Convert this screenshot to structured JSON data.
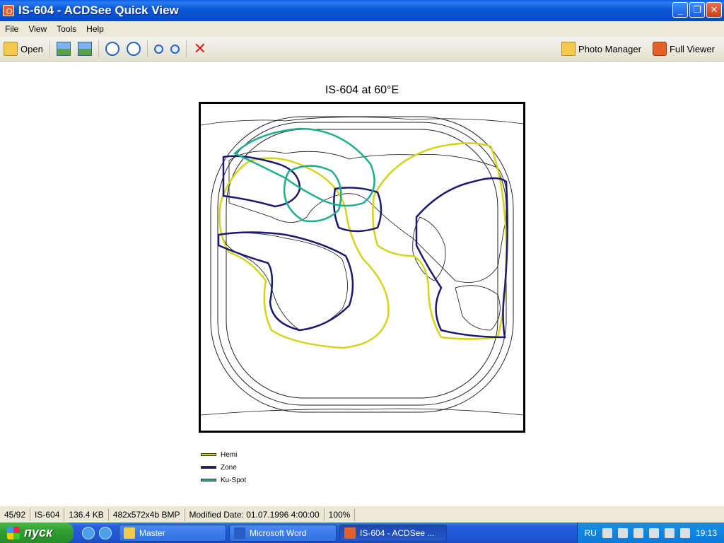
{
  "window": {
    "title": "IS-604 - ACDSee Quick View",
    "controls": [
      "minimize",
      "restore",
      "close"
    ]
  },
  "menu": [
    "File",
    "View",
    "Tools",
    "Help"
  ],
  "toolbar": {
    "open_label": "Open",
    "photo_manager_label": "Photo Manager",
    "full_viewer_label": "Full Viewer",
    "icons": [
      "open-icon",
      "previous-image-icon",
      "next-image-icon",
      "rotate-left-icon",
      "rotate-right-icon",
      "zoom-in-icon",
      "zoom-out-icon",
      "delete-icon",
      "photo-manager-icon",
      "full-viewer-icon"
    ]
  },
  "image": {
    "title": "IS-604 at 60°E",
    "legend": [
      {
        "label": "Hemi",
        "color": "#d4d41a"
      },
      {
        "label": "Zone",
        "color": "#1a1a6e"
      },
      {
        "label": "Ku-Spot",
        "color": "#1fae8e"
      }
    ]
  },
  "status": {
    "index": "45/92",
    "name": "IS-604",
    "size": "136.4 KB",
    "dimensions": "482x572x4b BMP",
    "modified": "Modified Date: 01.07.1996 4:00:00",
    "zoom": "100%"
  },
  "taskbar": {
    "start_label": "пуск",
    "tasks": [
      "Master",
      "Microsoft Word",
      "IS-604 - ACDSee ..."
    ],
    "language": "RU",
    "clock": "19:13"
  }
}
